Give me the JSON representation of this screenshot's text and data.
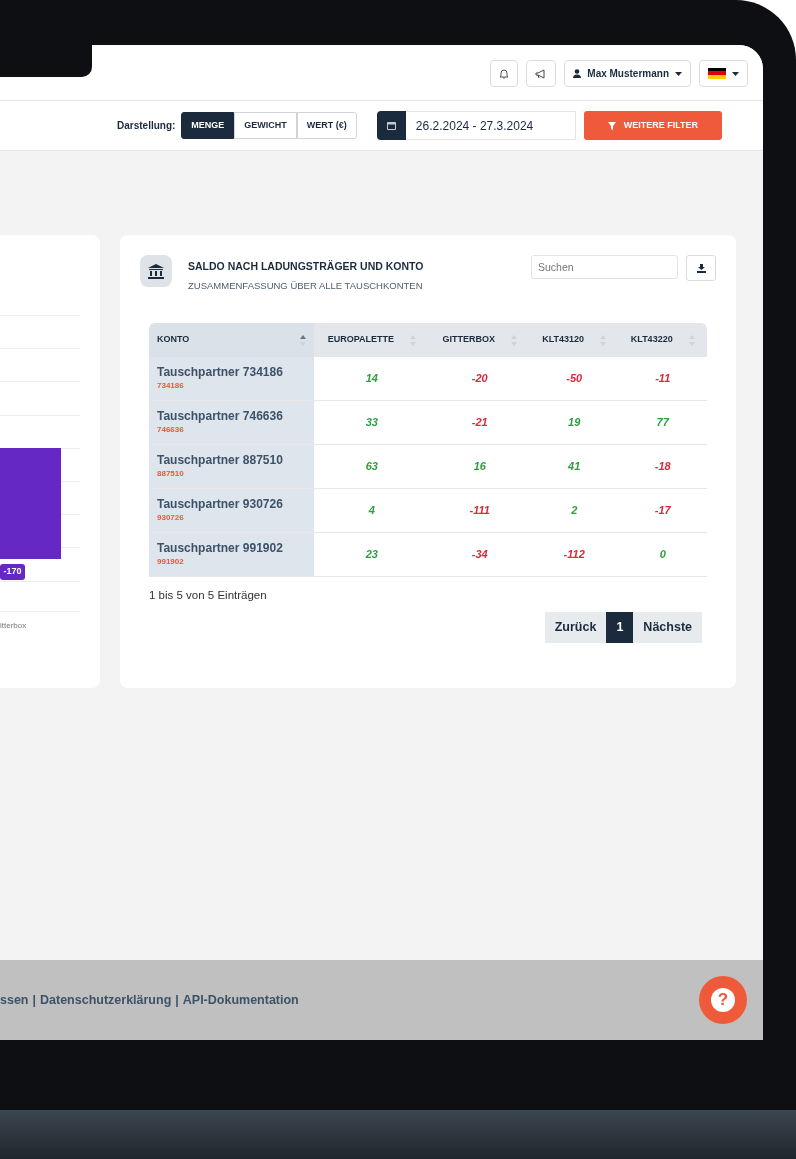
{
  "topbar": {
    "user": {
      "name": "Max Mustermann"
    }
  },
  "toolbar": {
    "label": "Darstellung:",
    "modes": [
      {
        "label": "MENGE",
        "selected": true
      },
      {
        "label": "GEWICHT",
        "selected": false
      },
      {
        "label": "WERT (€)",
        "selected": false
      }
    ],
    "date_range": "26.2.2024 - 27.3.2024",
    "filter_button": "WEITERE FILTER"
  },
  "left_card": {
    "bar_label": "-170",
    "axis_label": "itterbox"
  },
  "card": {
    "title": "SALDO NACH LADUNGSTRÄGER UND KONTO",
    "subtitle": "ZUSAMMENFASSUNG ÜBER ALLE TAUSCHKONTEN",
    "search": {
      "placeholder": "Suchen"
    },
    "table": {
      "columns": [
        {
          "label": "KONTO",
          "sorted": true
        },
        {
          "label": "EUROPALETTE",
          "sorted": false
        },
        {
          "label": "GITTERBOX",
          "sorted": false
        },
        {
          "label": "KLT43120",
          "sorted": false
        },
        {
          "label": "KLT43220",
          "sorted": false
        }
      ],
      "rows": [
        {
          "cells": [
            {
              "text": "Tauschpartner 734186",
              "sub": "734186"
            },
            {
              "text": "14",
              "color": "#2e9e3e"
            },
            {
              "text": "-20",
              "color": "#e0263b"
            },
            {
              "text": "-50",
              "color": "#e0263b"
            },
            {
              "text": "-11",
              "color": "#e0263b"
            }
          ]
        },
        {
          "cells": [
            {
              "text": "Tauschpartner 746636",
              "sub": "746636"
            },
            {
              "text": "33",
              "color": "#2e9e3e"
            },
            {
              "text": "-21",
              "color": "#e0263b"
            },
            {
              "text": "19",
              "color": "#2e9e3e"
            },
            {
              "text": "77",
              "color": "#2e9e3e"
            }
          ]
        },
        {
          "cells": [
            {
              "text": "Tauschpartner 887510",
              "sub": "887510"
            },
            {
              "text": "63",
              "color": "#2e9e3e"
            },
            {
              "text": "16",
              "color": "#2e9e3e"
            },
            {
              "text": "41",
              "color": "#2e9e3e"
            },
            {
              "text": "-18",
              "color": "#e0263b"
            }
          ]
        },
        {
          "cells": [
            {
              "text": "Tauschpartner 930726",
              "sub": "930726"
            },
            {
              "text": "4",
              "color": "#2e9e3e"
            },
            {
              "text": "-111",
              "color": "#e0263b"
            },
            {
              "text": "2",
              "color": "#2e9e3e"
            },
            {
              "text": "-17",
              "color": "#e0263b"
            }
          ]
        },
        {
          "cells": [
            {
              "text": "Tauschpartner 991902",
              "sub": "991902"
            },
            {
              "text": "23",
              "color": "#2e9e3e"
            },
            {
              "text": "-34",
              "color": "#e0263b"
            },
            {
              "text": "-112",
              "color": "#e0263b"
            },
            {
              "text": "0",
              "color": "#2e9e3e"
            }
          ]
        }
      ]
    },
    "info": "1 bis 5 von 5 Einträgen",
    "pagination": [
      {
        "label": "Zurück",
        "selected": false
      },
      {
        "label": "1",
        "selected": true
      },
      {
        "label": "Nächste",
        "selected": false
      }
    ]
  },
  "footer": {
    "items": [
      {
        "kind": "link",
        "text": "ssen"
      },
      {
        "kind": "separator",
        "text": "|"
      },
      {
        "kind": "link",
        "text": "Datenschutzerklärung"
      },
      {
        "kind": "separator",
        "text": "|"
      },
      {
        "kind": "link",
        "text": "API-Dokumentation"
      }
    ],
    "help_button": "?"
  }
}
